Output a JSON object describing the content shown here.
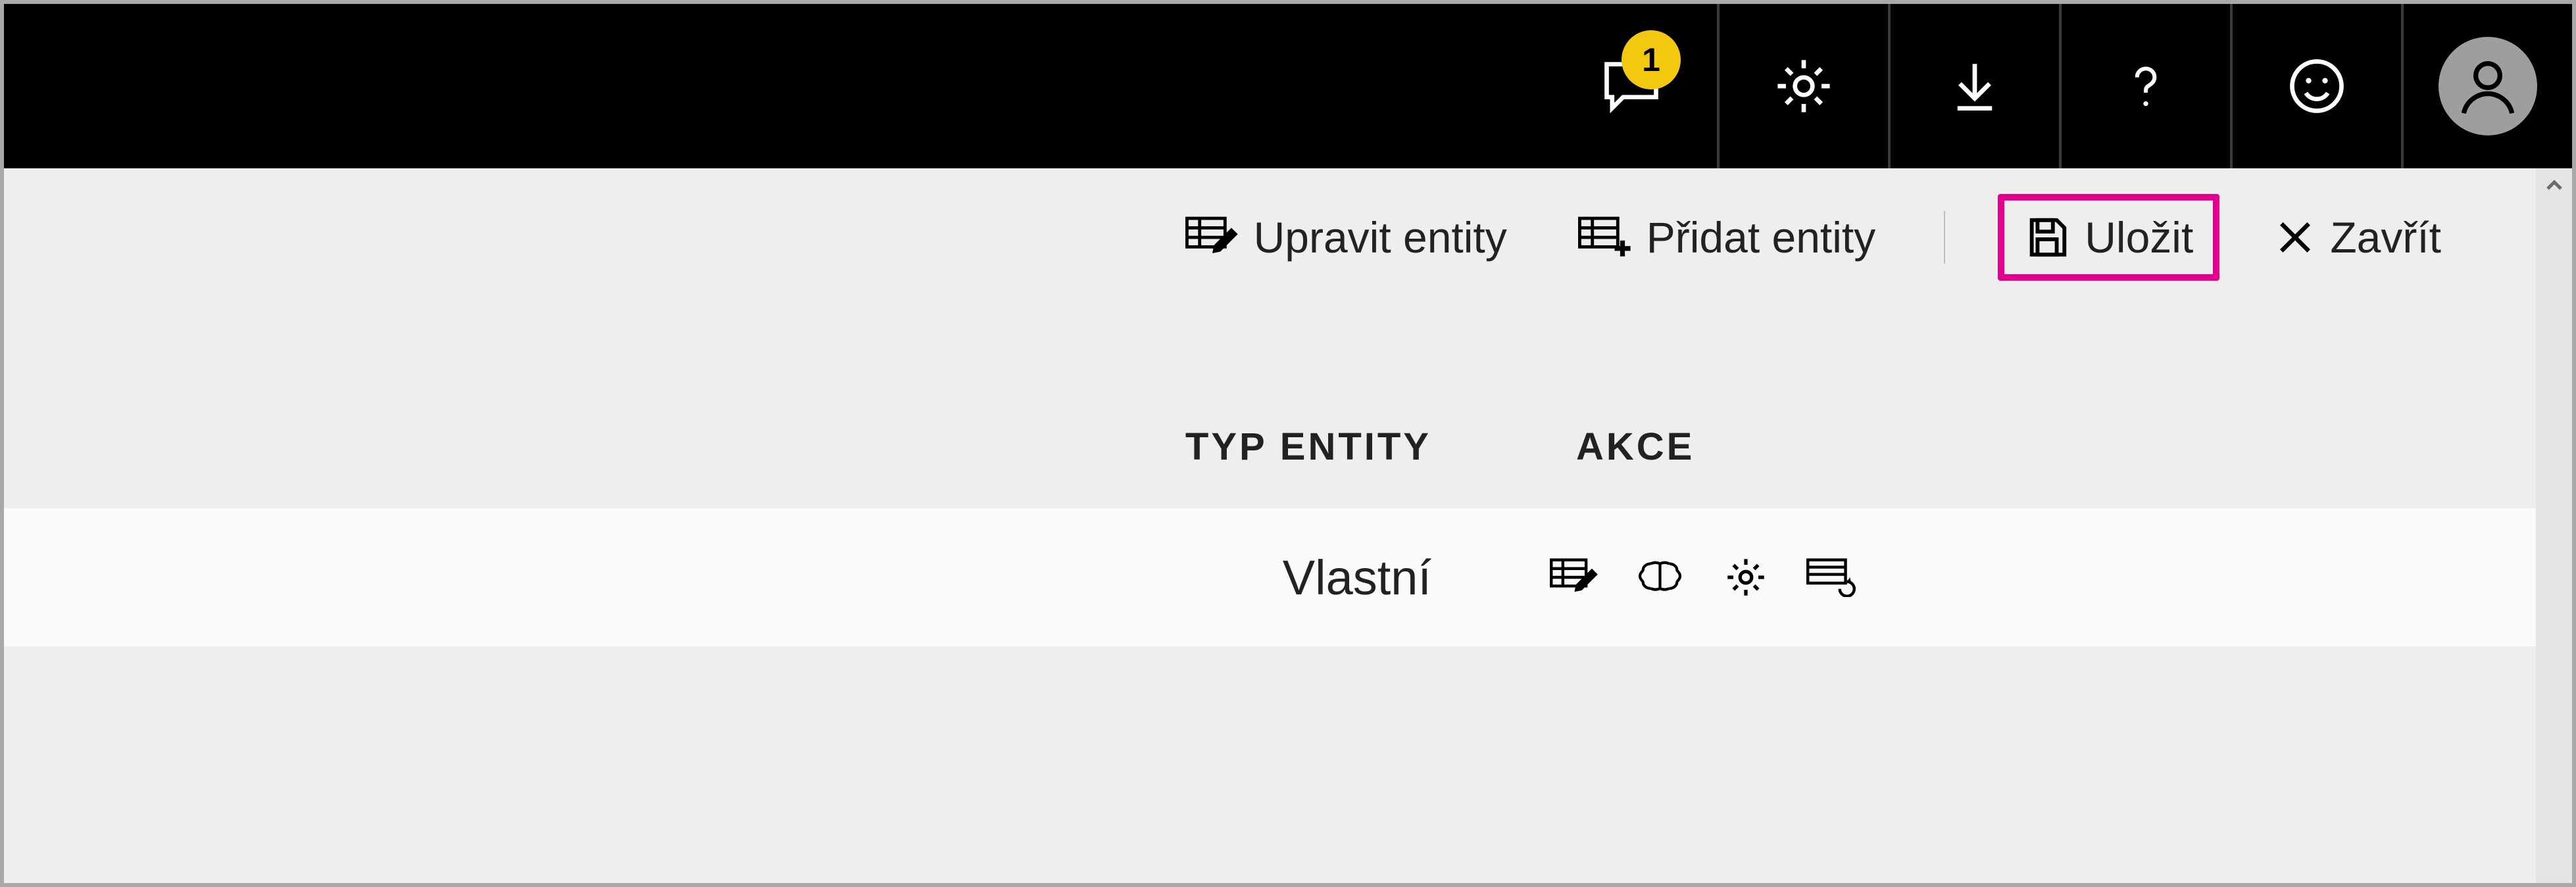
{
  "topbar": {
    "notification_badge": "1"
  },
  "toolbar": {
    "edit_entities_label": "Upravit entity",
    "add_entities_label": "Přidat entity",
    "save_label": "Uložit",
    "close_label": "Zavřít"
  },
  "headers": {
    "entity_type": "TYP ENTITY",
    "actions": "AKCE"
  },
  "rows": [
    {
      "entity_type": "Vlastní"
    }
  ]
}
